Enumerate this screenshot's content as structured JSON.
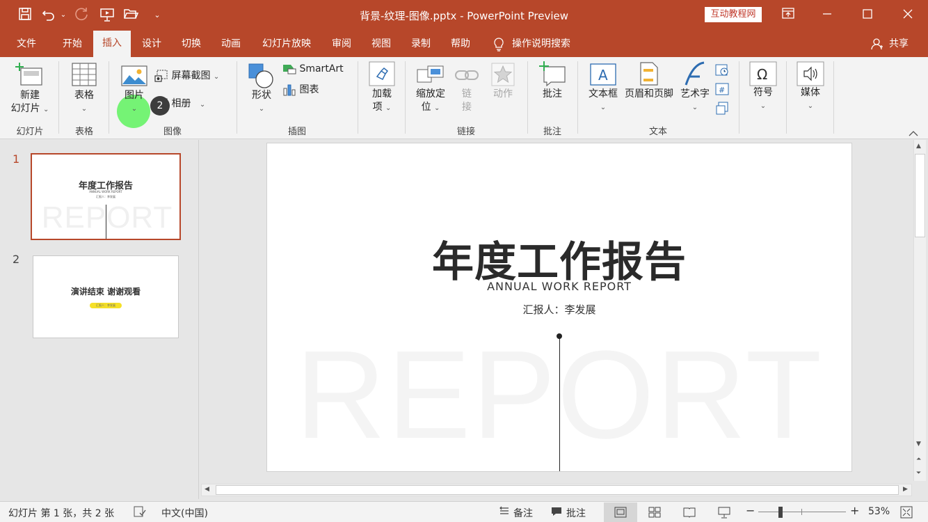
{
  "window": {
    "title": "背景-纹理-图像.pptx - PowerPoint Preview",
    "badge": "互动教程网"
  },
  "menu": {
    "tabs": [
      "文件",
      "开始",
      "插入",
      "设计",
      "切换",
      "动画",
      "幻灯片放映",
      "审阅",
      "视图",
      "录制",
      "帮助"
    ],
    "active_tab": "插入",
    "tell_me": "操作说明搜索",
    "share": "共享"
  },
  "ribbon": {
    "new_slide": [
      "新建",
      "幻灯片"
    ],
    "table": "表格",
    "picture": "图片",
    "screenshot": "屏幕截图",
    "album": "相册",
    "step_badge": "2",
    "shapes": "形状",
    "smartart": "SmartArt",
    "chart": "图表",
    "addins": [
      "加载",
      "项"
    ],
    "zoom": [
      "缩放定",
      "位"
    ],
    "link": [
      "链",
      "接"
    ],
    "action": "动作",
    "comment": "批注",
    "textbox": "文本框",
    "header_footer": "页眉和页脚",
    "wordart": "艺术字",
    "symbol": "符号",
    "media": "媒体",
    "groups": {
      "slides": "幻灯片",
      "tables": "表格",
      "images": "图像",
      "illustrations": "插图",
      "links": "链接",
      "comments": "批注",
      "text": "文本"
    }
  },
  "slides": [
    {
      "number": "1",
      "title": "年度工作报告",
      "subtitle": "ANNUAL WORK REPORT",
      "reporter": "汇报人：李发展",
      "watermark": "REPORT"
    },
    {
      "number": "2",
      "title": "演讲结束 谢谢观看",
      "tag": "汇报人：李发展"
    }
  ],
  "status": {
    "slide_info": "幻灯片 第 1 张，共 2 张",
    "language": "中文(中国)",
    "notes": "备注",
    "comments": "批注",
    "zoom": "53%",
    "zoom_level": 0.53
  },
  "colors": {
    "accent": "#b7472a",
    "ribbon_bg": "#f3f3f3",
    "highlight": "#5ef25e",
    "thumb_tag": "#f5e028"
  }
}
